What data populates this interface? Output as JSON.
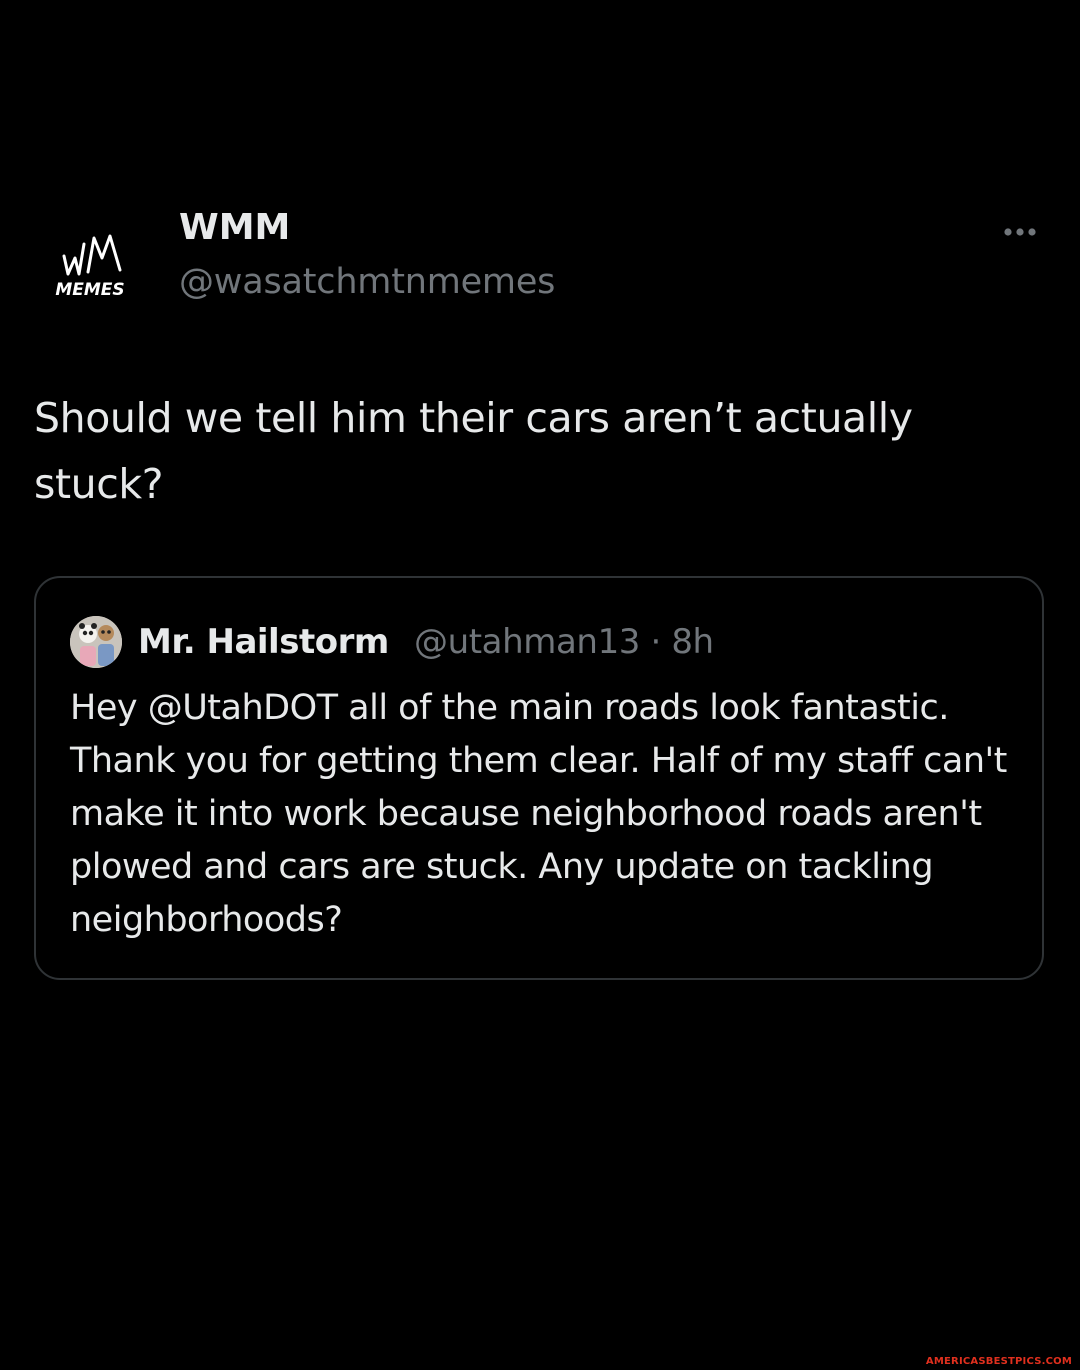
{
  "tweet": {
    "author": {
      "display_name": "WMM",
      "handle": "@wasatchmtnmemes",
      "avatar_logo_text": "WM",
      "avatar_logo_subtext": "MEMES"
    },
    "more_icon": "more-horizontal-icon",
    "text": "Should we tell him their cars aren’t actually stuck?"
  },
  "quote": {
    "author": {
      "display_name": "Mr. Hailstorm",
      "handle": "@utahman13",
      "separator": "·",
      "time": "8h",
      "avatar_icon": "profile-photo"
    },
    "text": "Hey @UtahDOT all of the main roads look fantastic. Thank you for getting them clear. Half of my staff can't make it into work because neighborhood roads aren't plowed and cars are stuck. Any update on tackling neighborhoods?"
  },
  "watermark": {
    "text": "AMERICASBESTPICS.COM"
  },
  "colors": {
    "background": "#000000",
    "primary_text": "#e7e9ea",
    "secondary_text": "#71767b",
    "border": "#2f3336",
    "watermark": "#e0301e"
  }
}
